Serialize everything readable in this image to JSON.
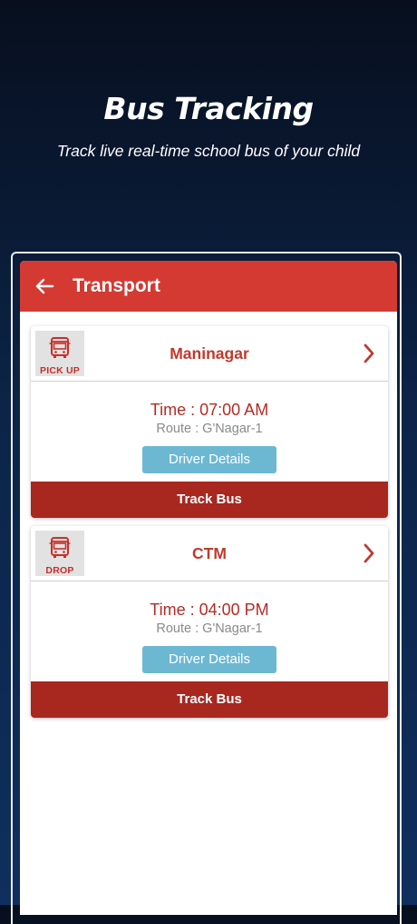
{
  "hero": {
    "title": "Bus Tracking",
    "subtitle": "Track live real-time school bus of your child"
  },
  "app_bar": {
    "back_icon": "arrow-left-icon",
    "title": "Transport"
  },
  "colors": {
    "primary_red": "#d43a32",
    "track_button": "#a8271f",
    "driver_button": "#6cb8d3",
    "background_dark": "#0c2448"
  },
  "trips": [
    {
      "badge": "PICK UP",
      "badge_icon": "bus-icon",
      "stop": "Maninagar",
      "time": "Time : 07:00 AM",
      "route": "Route : G'Nagar-1",
      "driver_button": "Driver Details",
      "track_button": "Track Bus"
    },
    {
      "badge": "DROP",
      "badge_icon": "bus-icon",
      "stop": "CTM",
      "time": "Time : 04:00 PM",
      "route": "Route : G'Nagar-1",
      "driver_button": "Driver Details",
      "track_button": "Track Bus"
    }
  ]
}
